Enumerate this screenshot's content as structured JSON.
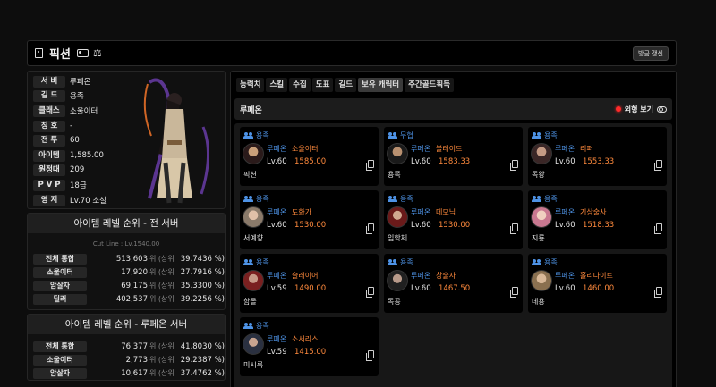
{
  "header": {
    "name": "픽션",
    "refresh_label": "방금 갱신"
  },
  "profile": {
    "stats": [
      {
        "key": "서 버",
        "value": "루페온"
      },
      {
        "key": "길 드",
        "value": "용족"
      },
      {
        "key": "클래스",
        "value": "소울이터"
      },
      {
        "key": "칭 호",
        "value": "-"
      },
      {
        "key": "전 투",
        "value": "60"
      },
      {
        "key": "아이템",
        "value": "1,585.00"
      },
      {
        "key": "원정대",
        "value": "209"
      },
      {
        "key": "P V P",
        "value": "18급"
      },
      {
        "key": "영 지",
        "value": "Lv.70 소설"
      }
    ]
  },
  "rank_all": {
    "title": "아이템 레벨 순위 - 전 서버",
    "cutline": "Cut Line : Lv.1540.00",
    "rows": [
      {
        "label": "전체 통합",
        "rank": "513,603",
        "unit": "위 (상위",
        "pct": "39.7436 %)"
      },
      {
        "label": "소울이터",
        "rank": "17,920",
        "unit": "위 (상위",
        "pct": "27.7916 %)"
      },
      {
        "label": "암살자",
        "rank": "69,175",
        "unit": "위 (상위",
        "pct": "35.3300 %)"
      },
      {
        "label": "딜러",
        "rank": "402,537",
        "unit": "위 (상위",
        "pct": "39.2256 %)"
      }
    ]
  },
  "rank_server": {
    "title": "아이템 레벨 순위 - 루페온 서버",
    "rows": [
      {
        "label": "전체 통합",
        "rank": "76,377",
        "unit": "위 (상위",
        "pct": "41.8030 %)"
      },
      {
        "label": "소울이터",
        "rank": "2,773",
        "unit": "위 (상위",
        "pct": "29.2387 %)"
      },
      {
        "label": "암살자",
        "rank": "10,617",
        "unit": "위 (상위",
        "pct": "37.4762 %)"
      }
    ]
  },
  "tabs": [
    "능력치",
    "스킬",
    "수집",
    "도표",
    "길드",
    "보유 캐릭터",
    "주간골드획득"
  ],
  "active_tab": "보유 캐릭터",
  "server_section": {
    "server": "루페온",
    "toggle_label": "외형 보기"
  },
  "characters": [
    {
      "guild": "용족",
      "server": "루페온",
      "class": "소울이터",
      "level": "Lv.60",
      "ilvl": "1585.00",
      "name": "픽션"
    },
    {
      "guild": "무협",
      "server": "루페온",
      "class": "블레이드",
      "level": "Lv.60",
      "ilvl": "1583.33",
      "name": "용족"
    },
    {
      "guild": "용족",
      "server": "루페온",
      "class": "리퍼",
      "level": "Lv.60",
      "ilvl": "1553.33",
      "name": "독왕"
    },
    {
      "guild": "용족",
      "server": "루페온",
      "class": "도화가",
      "level": "Lv.60",
      "ilvl": "1530.00",
      "name": "서예향"
    },
    {
      "guild": "용족",
      "server": "루페온",
      "class": "데모닉",
      "level": "Lv.60",
      "ilvl": "1530.00",
      "name": "임학체"
    },
    {
      "guild": "용족",
      "server": "루페온",
      "class": "기상술사",
      "level": "Lv.60",
      "ilvl": "1518.33",
      "name": "지룡"
    },
    {
      "guild": "용족",
      "server": "루페온",
      "class": "슬레이어",
      "level": "Lv.59",
      "ilvl": "1490.00",
      "name": "함몰"
    },
    {
      "guild": "용족",
      "server": "루페온",
      "class": "창술사",
      "level": "Lv.60",
      "ilvl": "1467.50",
      "name": "독공"
    },
    {
      "guild": "용족",
      "server": "루페온",
      "class": "홀리나이트",
      "level": "Lv.60",
      "ilvl": "1460.00",
      "name": "데용"
    },
    {
      "guild": "용족",
      "server": "루페온",
      "class": "소서리스",
      "level": "Lv.59",
      "ilvl": "1415.00",
      "name": "미시록"
    }
  ],
  "colors": {
    "accent_blue": "#4e93e6",
    "ilvl_orange": "#ff8a3d",
    "indicator_red": "#ff2a2a"
  }
}
